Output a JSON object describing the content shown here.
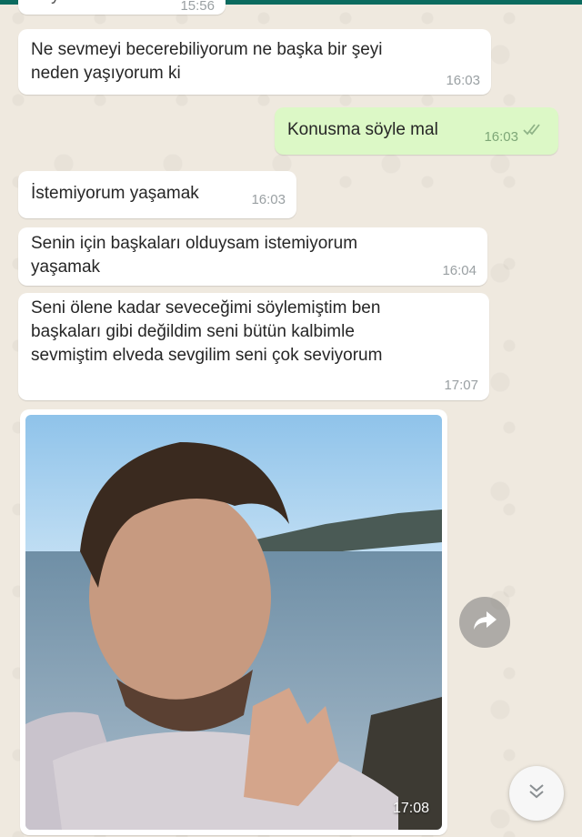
{
  "messages": [
    {
      "text": "Zayıf Maraduk",
      "time": "15:56"
    },
    {
      "text": "Ne sevmeyi becerebiliyorum ne başka bir şeyi\nneden yaşıyorum ki",
      "time": "16:03"
    },
    {
      "text": "Konusma söyle mal",
      "time": "16:03"
    },
    {
      "text": "İstemiyorum yaşamak",
      "time": "16:03"
    },
    {
      "text": "Senin için başkaları olduysam istemiyorum\nyaşamak",
      "time": "16:04"
    },
    {
      "text": "Seni ölene kadar seveceğimi söylemiştim ben\nbaşkaları gibi değildim seni bütün kalbimle\nsevmiştim elveda sevgilim seni çok seviyorum",
      "time": "17:07"
    }
  ],
  "photo_message": {
    "time": "17:08"
  },
  "icons": {
    "read_receipt": "double-check-icon",
    "forward": "forward-arrow-icon",
    "scroll": "double-chevron-down-icon"
  },
  "colors": {
    "chat_background": "#efe9df",
    "incoming_bubble": "#ffffff",
    "outgoing_bubble": "#dcf8c6",
    "header": "#0b6b5f"
  }
}
